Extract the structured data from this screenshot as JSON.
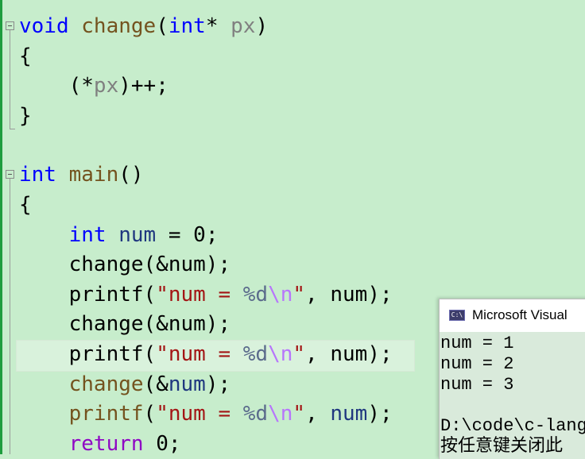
{
  "editor": {
    "lines": [
      {
        "segments": [
          {
            "cls": "kw",
            "text": "void"
          },
          {
            "cls": "pl",
            "text": " "
          },
          {
            "cls": "fn",
            "text": "change"
          },
          {
            "cls": "pl",
            "text": "("
          },
          {
            "cls": "kw",
            "text": "int"
          },
          {
            "cls": "pl",
            "text": "* "
          },
          {
            "cls": "prm",
            "text": "px"
          },
          {
            "cls": "pl",
            "text": ")"
          }
        ]
      },
      {
        "segments": [
          {
            "cls": "pl",
            "text": "{"
          }
        ]
      },
      {
        "segments": [
          {
            "cls": "pl",
            "text": "    (*"
          },
          {
            "cls": "prm",
            "text": "px"
          },
          {
            "cls": "pl",
            "text": ")++;"
          }
        ]
      },
      {
        "segments": [
          {
            "cls": "pl",
            "text": "}"
          }
        ]
      },
      {
        "segments": []
      },
      {
        "segments": [
          {
            "cls": "kw",
            "text": "int"
          },
          {
            "cls": "pl",
            "text": " "
          },
          {
            "cls": "fn",
            "text": "main"
          },
          {
            "cls": "pl",
            "text": "()"
          }
        ]
      },
      {
        "segments": [
          {
            "cls": "pl",
            "text": "{"
          }
        ]
      },
      {
        "segments": [
          {
            "cls": "pl",
            "text": "    "
          },
          {
            "cls": "kw",
            "text": "int"
          },
          {
            "cls": "pl",
            "text": " "
          },
          {
            "cls": "var",
            "text": "num"
          },
          {
            "cls": "pl",
            "text": " = 0;"
          }
        ]
      },
      {
        "segments": [
          {
            "cls": "pl",
            "text": "    change(&num);"
          }
        ]
      },
      {
        "segments": [
          {
            "cls": "pl",
            "text": "    printf("
          },
          {
            "cls": "str",
            "text": "\"num = "
          },
          {
            "cls": "fmt",
            "text": "%d"
          },
          {
            "cls": "esc",
            "text": "\\n"
          },
          {
            "cls": "str",
            "text": "\""
          },
          {
            "cls": "pl",
            "text": ", num);"
          }
        ]
      },
      {
        "segments": [
          {
            "cls": "pl",
            "text": "    change(&num);"
          }
        ]
      },
      {
        "segments": [
          {
            "cls": "pl",
            "text": "    printf("
          },
          {
            "cls": "str",
            "text": "\"num = "
          },
          {
            "cls": "fmt",
            "text": "%d"
          },
          {
            "cls": "esc",
            "text": "\\n"
          },
          {
            "cls": "str",
            "text": "\""
          },
          {
            "cls": "pl",
            "text": ", num);"
          }
        ]
      },
      {
        "segments": [
          {
            "cls": "pl",
            "text": "    "
          },
          {
            "cls": "fn",
            "text": "change"
          },
          {
            "cls": "pl",
            "text": "(&"
          },
          {
            "cls": "var",
            "text": "num"
          },
          {
            "cls": "pl",
            "text": ");"
          }
        ]
      },
      {
        "segments": [
          {
            "cls": "pl",
            "text": "    "
          },
          {
            "cls": "fn",
            "text": "printf"
          },
          {
            "cls": "pl",
            "text": "("
          },
          {
            "cls": "str",
            "text": "\"num = "
          },
          {
            "cls": "fmt",
            "text": "%d"
          },
          {
            "cls": "esc",
            "text": "\\n"
          },
          {
            "cls": "str",
            "text": "\""
          },
          {
            "cls": "pl",
            "text": ", "
          },
          {
            "cls": "var",
            "text": "num"
          },
          {
            "cls": "pl",
            "text": ");"
          }
        ]
      },
      {
        "segments": [
          {
            "cls": "pl",
            "text": "    "
          },
          {
            "cls": "ctl",
            "text": "return"
          },
          {
            "cls": "pl",
            "text": " 0;"
          }
        ]
      }
    ]
  },
  "console_popup": {
    "title": "Microsoft Visual",
    "icon_text": "C:\\",
    "lines": [
      "num = 1",
      "num = 2",
      "num = 3",
      "",
      "D:\\code\\c-lang",
      "按任意键关闭此"
    ]
  },
  "colors": {
    "editor_background": "#c7edcc",
    "keyword": "#0000ff",
    "function": "#74531f",
    "string": "#a31515"
  }
}
